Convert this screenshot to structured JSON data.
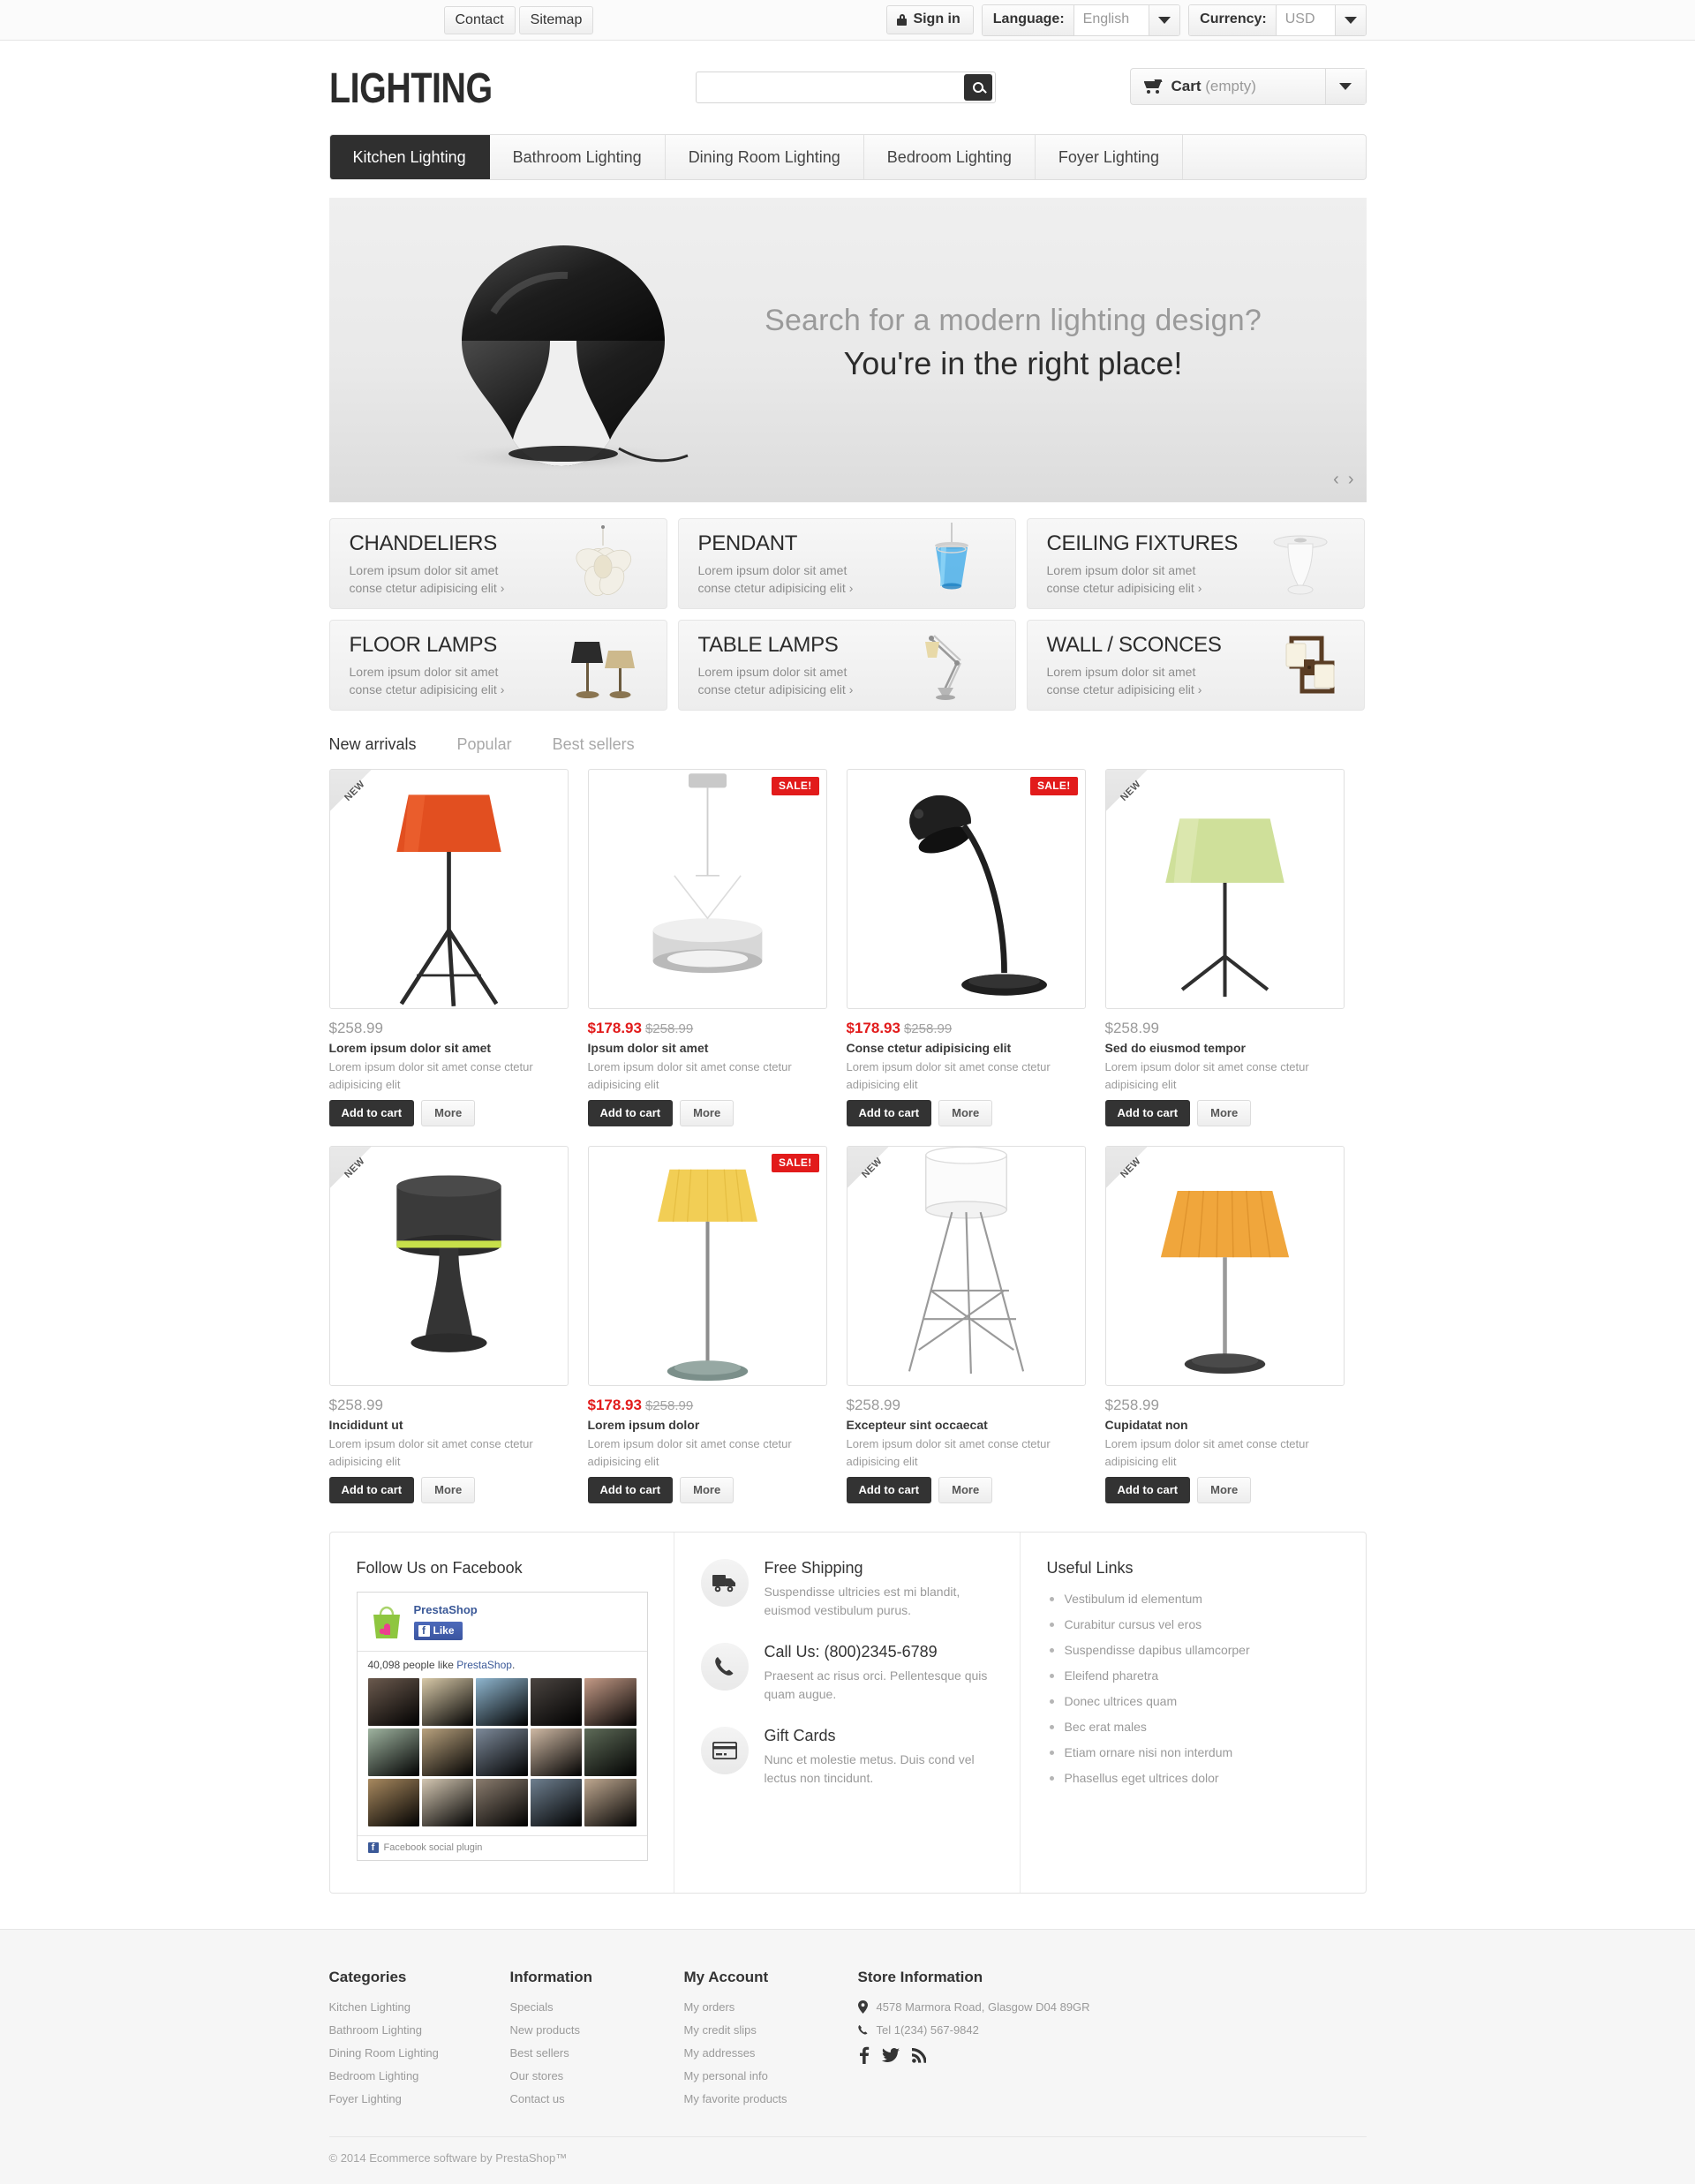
{
  "topbar": {
    "contact": "Contact",
    "sitemap": "Sitemap",
    "sign_in": "Sign in",
    "language_label": "Language:",
    "language_value": "English",
    "currency_label": "Currency:",
    "currency_value": "USD"
  },
  "header": {
    "logo": "LIGHTING",
    "search_placeholder": "",
    "search_value": "",
    "cart_label": "Cart",
    "cart_status": "(empty)"
  },
  "nav": {
    "items": [
      {
        "label": "Kitchen Lighting",
        "active": true
      },
      {
        "label": "Bathroom Lighting",
        "active": false
      },
      {
        "label": "Dining Room Lighting",
        "active": false
      },
      {
        "label": "Bedroom Lighting",
        "active": false
      },
      {
        "label": "Foyer Lighting",
        "active": false
      }
    ]
  },
  "hero": {
    "line1": "Search for a modern lighting design?",
    "line2": "You're in the right place!",
    "prev": "‹",
    "next": "›"
  },
  "categories": [
    {
      "title": "CHANDELIERS",
      "desc": "Lorem ipsum dolor sit amet conse ctetur adipisicing elit ›"
    },
    {
      "title": "PENDANT",
      "desc": "Lorem ipsum dolor sit amet conse ctetur adipisicing elit ›"
    },
    {
      "title": "CEILING FIXTURES",
      "desc": "Lorem ipsum dolor sit amet conse ctetur adipisicing elit ›"
    },
    {
      "title": "FLOOR LAMPS",
      "desc": "Lorem ipsum dolor sit amet conse ctetur adipisicing elit ›"
    },
    {
      "title": "TABLE LAMPS",
      "desc": "Lorem ipsum dolor sit amet conse ctetur adipisicing elit ›"
    },
    {
      "title": "WALL / SCONCES",
      "desc": "Lorem ipsum dolor sit amet conse ctetur adipisicing elit ›"
    }
  ],
  "product_tabs": [
    {
      "label": "New arrivals",
      "active": true
    },
    {
      "label": "Popular",
      "active": false
    },
    {
      "label": "Best sellers",
      "active": false
    }
  ],
  "product_buttons": {
    "add_to_cart": "Add to cart",
    "more": "More"
  },
  "badges": {
    "new": "NEW",
    "sale": "SALE!"
  },
  "products": [
    {
      "price": "$258.99",
      "old_price": "",
      "on_sale": false,
      "badge": "new",
      "name": "Lorem ipsum dolor sit amet",
      "desc": "Lorem ipsum dolor sit amet conse ctetur adipisicing elit",
      "img": "floor-lamp-orange"
    },
    {
      "price": "$178.93",
      "old_price": "$258.99",
      "on_sale": true,
      "badge": "sale",
      "name": "Ipsum dolor sit amet",
      "desc": "Lorem ipsum dolor sit amet conse ctetur adipisicing elit",
      "img": "pendant-drum"
    },
    {
      "price": "$178.93",
      "old_price": "$258.99",
      "on_sale": true,
      "badge": "sale",
      "name": "Conse ctetur adipisicing elit",
      "desc": "Lorem ipsum dolor sit amet conse ctetur adipisicing elit",
      "img": "desk-lamp-black"
    },
    {
      "price": "$258.99",
      "old_price": "",
      "on_sale": false,
      "badge": "new",
      "name": "Sed do eiusmod tempor",
      "desc": "Lorem ipsum dolor sit amet conse ctetur adipisicing elit",
      "img": "table-lamp-green"
    },
    {
      "price": "$258.99",
      "old_price": "",
      "on_sale": false,
      "badge": "new",
      "name": "Incididunt ut",
      "desc": "Lorem ipsum dolor sit amet conse ctetur adipisicing elit",
      "img": "table-lamp-dark"
    },
    {
      "price": "$178.93",
      "old_price": "$258.99",
      "on_sale": true,
      "badge": "sale",
      "name": "Lorem ipsum dolor",
      "desc": "Lorem ipsum dolor sit amet conse ctetur adipisicing elit",
      "img": "floor-lamp-yellow"
    },
    {
      "price": "$258.99",
      "old_price": "",
      "on_sale": false,
      "badge": "new",
      "name": "Excepteur sint occaecat",
      "desc": "Lorem ipsum dolor sit amet conse ctetur adipisicing elit",
      "img": "tripod-lamp-white"
    },
    {
      "price": "$258.99",
      "old_price": "",
      "on_sale": false,
      "badge": "new",
      "name": "Cupidatat non",
      "desc": "Lorem ipsum dolor sit amet conse ctetur adipisicing elit",
      "img": "table-lamp-orange"
    }
  ],
  "facebook": {
    "title": "Follow Us on Facebook",
    "page_name": "PrestaShop",
    "like_label": "Like",
    "count_text": "40,098 people like PrestaShop.",
    "count_prefix": "40,098 people like ",
    "count_link": "PrestaShop",
    "count_suffix": ".",
    "plugin_label": "Facebook social plugin"
  },
  "services": [
    {
      "icon": "truck-icon",
      "title": "Free Shipping",
      "desc": "Suspendisse ultricies est mi blandit, euismod vestibulum purus."
    },
    {
      "icon": "phone-icon",
      "title": "Call Us: (800)2345-6789",
      "desc": "Praesent ac risus orci. Pellentesque quis quam augue."
    },
    {
      "icon": "credit-card-icon",
      "title": "Gift Cards",
      "desc": "Nunc et molestie metus. Duis cond vel lectus non tincidunt."
    }
  ],
  "useful_links": {
    "title": "Useful Links",
    "items": [
      "Vestibulum id elementum",
      "Curabitur cursus vel eros",
      "Suspendisse dapibus ullamcorper",
      "Eleifend pharetra",
      "Donec ultrices quam",
      "Bec erat males",
      "Etiam ornare nisi non interdum",
      "Phasellus eget ultrices dolor"
    ]
  },
  "footer": {
    "categories": {
      "title": "Categories",
      "items": [
        "Kitchen Lighting",
        "Bathroom Lighting",
        "Dining Room Lighting",
        "Bedroom Lighting",
        "Foyer Lighting"
      ]
    },
    "information": {
      "title": "Information",
      "items": [
        "Specials",
        "New products",
        "Best sellers",
        "Our stores",
        "Contact us"
      ]
    },
    "my_account": {
      "title": "My Account",
      "items": [
        "My orders",
        "My credit slips",
        "My addresses",
        "My personal info",
        "My favorite products"
      ]
    },
    "store": {
      "title": "Store Information",
      "address": "4578 Marmora Road, Glasgow D04 89GR",
      "phone": "Tel 1(234) 567-9842"
    },
    "copyright": "© 2014 Ecommerce software by PrestaShop™"
  },
  "colors": {
    "accent_red": "#e21b1b",
    "dark": "#2f2f2f",
    "facebook_blue": "#3b5998"
  }
}
